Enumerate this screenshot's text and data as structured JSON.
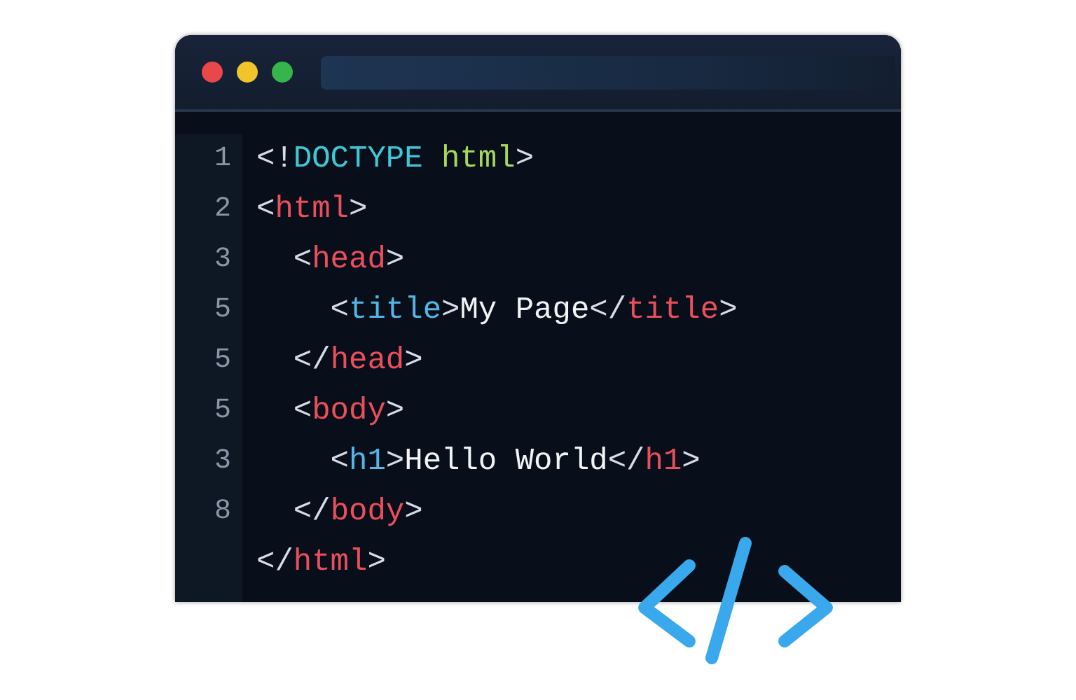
{
  "window": {
    "controls": [
      {
        "color": "#e8484a"
      },
      {
        "color": "#f2c42c"
      },
      {
        "color": "#35b54a"
      }
    ]
  },
  "editor": {
    "lines": [
      {
        "number": "1",
        "tokens": [
          {
            "kind": "punct",
            "text": "<!"
          },
          {
            "kind": "doctype",
            "text": "DOCTYPE"
          },
          {
            "kind": "keyword",
            "text": " html"
          },
          {
            "kind": "punct",
            "text": ">"
          }
        ]
      },
      {
        "number": "2",
        "tokens": [
          {
            "kind": "punct",
            "text": "<"
          },
          {
            "kind": "tag",
            "text": "html"
          },
          {
            "kind": "punct",
            "text": ">"
          }
        ]
      },
      {
        "number": "3",
        "tokens": [
          {
            "kind": "punct",
            "text": "  <"
          },
          {
            "kind": "tag",
            "text": "head"
          },
          {
            "kind": "punct",
            "text": ">"
          }
        ]
      },
      {
        "number": "5",
        "tokens": [
          {
            "kind": "punct",
            "text": "    <"
          },
          {
            "kind": "element",
            "text": "title"
          },
          {
            "kind": "punct",
            "text": ">"
          },
          {
            "kind": "text",
            "text": "My Page"
          },
          {
            "kind": "punct",
            "text": "</"
          },
          {
            "kind": "tag",
            "text": "title"
          },
          {
            "kind": "punct",
            "text": ">"
          }
        ]
      },
      {
        "number": "5",
        "tokens": [
          {
            "kind": "punct",
            "text": "  </"
          },
          {
            "kind": "tag",
            "text": "head"
          },
          {
            "kind": "punct",
            "text": ">"
          }
        ]
      },
      {
        "number": "5",
        "tokens": [
          {
            "kind": "punct",
            "text": "  <"
          },
          {
            "kind": "tag",
            "text": "body"
          },
          {
            "kind": "punct",
            "text": ">"
          }
        ]
      },
      {
        "number": "3",
        "tokens": [
          {
            "kind": "punct",
            "text": "    <"
          },
          {
            "kind": "element",
            "text": "h1"
          },
          {
            "kind": "punct",
            "text": ">"
          },
          {
            "kind": "text",
            "text": "Hello World"
          },
          {
            "kind": "punct",
            "text": "</"
          },
          {
            "kind": "tag",
            "text": "h1"
          },
          {
            "kind": "punct",
            "text": ">"
          }
        ]
      },
      {
        "number": "8",
        "tokens": [
          {
            "kind": "punct",
            "text": "  </"
          },
          {
            "kind": "tag",
            "text": "body"
          },
          {
            "kind": "punct",
            "text": ">"
          }
        ]
      },
      {
        "tokens": [
          {
            "kind": "punct",
            "text": "</"
          },
          {
            "kind": "tag",
            "text": "html"
          },
          {
            "kind": "punct",
            "text": ">"
          }
        ]
      }
    ]
  }
}
